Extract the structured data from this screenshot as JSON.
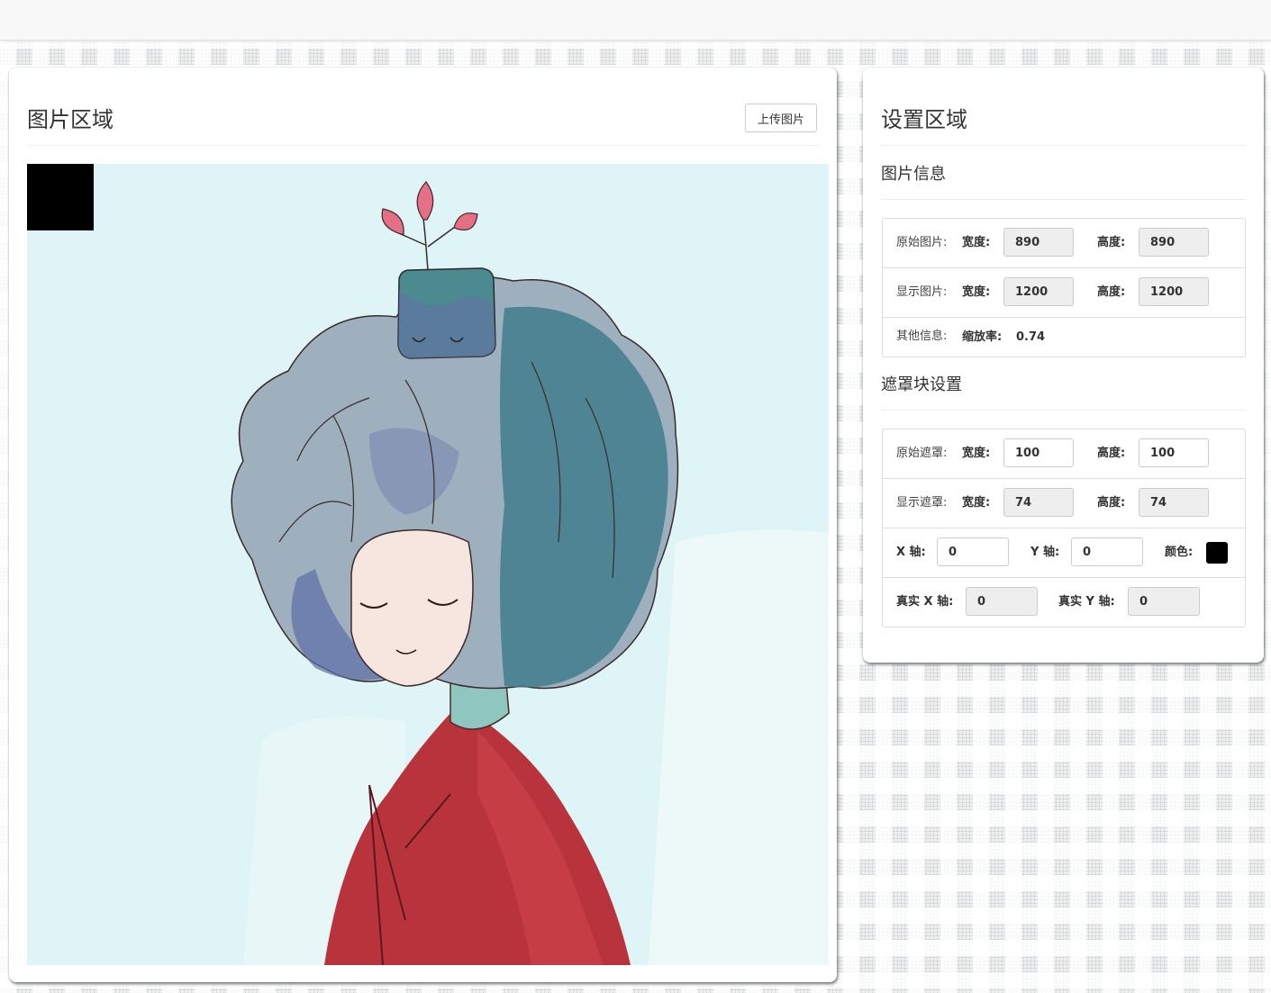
{
  "left_panel": {
    "title": "图片区域",
    "upload_label": "上传图片"
  },
  "right_panel": {
    "title": "设置区域",
    "image_info": {
      "heading": "图片信息",
      "original_label": "原始图片:",
      "display_label": "显示图片:",
      "other_label": "其他信息:",
      "width_label": "宽度:",
      "height_label": "高度:",
      "scale_label": "缩放率:",
      "original_width": "890",
      "original_height": "890",
      "display_width": "1200",
      "display_height": "1200",
      "scale": "0.74"
    },
    "mask_settings": {
      "heading": "遮罩块设置",
      "original_label": "原始遮罩:",
      "display_label": "显示遮罩:",
      "width_label": "宽度:",
      "height_label": "高度:",
      "original_width": "100",
      "original_height": "100",
      "display_width": "74",
      "display_height": "74",
      "x_label": "X 轴:",
      "y_label": "Y 轴:",
      "color_label": "颜色:",
      "x_value": "0",
      "y_value": "0",
      "real_x_label": "真实 X 轴:",
      "real_y_label": "真实 Y 轴:",
      "real_x_value": "0",
      "real_y_value": "0",
      "mask_color": "#000000"
    }
  },
  "colors": {
    "image_background": "#dff3f5",
    "mask": "#000000"
  },
  "icons": {
    "upload": "upload-button",
    "color": "color-swatch"
  }
}
